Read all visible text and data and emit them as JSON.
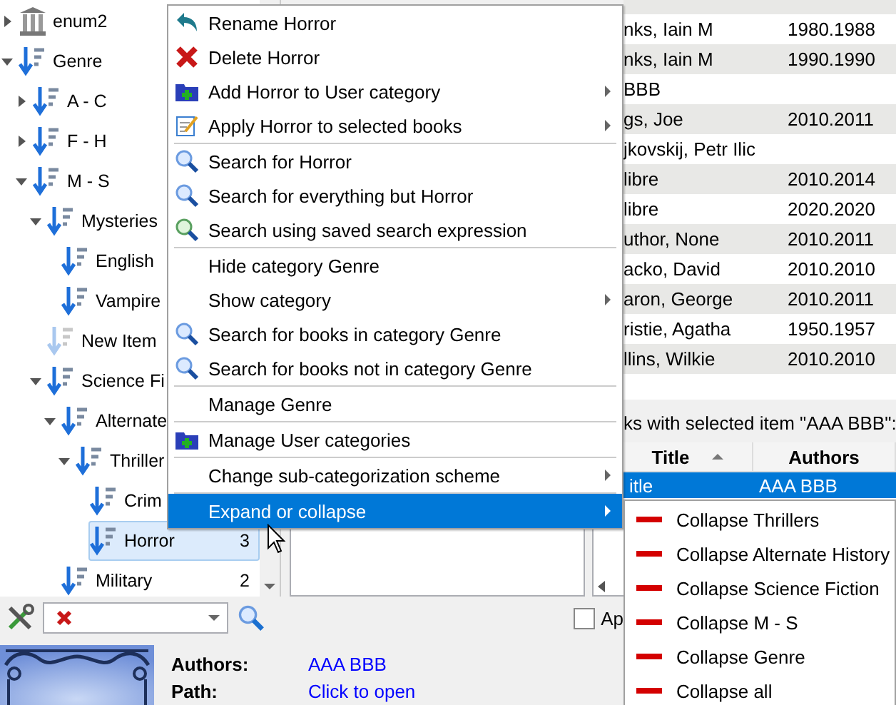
{
  "tree": [
    {
      "label": "enum2",
      "kind": "enum",
      "expanded": false,
      "faded": false,
      "selected": false
    },
    {
      "label": "Genre",
      "kind": "category",
      "expanded": true,
      "faded": false,
      "selected": false,
      "children": [
        {
          "label": "A - C",
          "kind": "category",
          "expanded": false,
          "faded": false,
          "selected": false
        },
        {
          "label": "F - H",
          "kind": "category",
          "expanded": false,
          "faded": false,
          "selected": false
        },
        {
          "label": "M - S",
          "kind": "category",
          "expanded": true,
          "faded": false,
          "selected": false,
          "children": [
            {
              "label": "Mysteries",
              "kind": "category",
              "expanded": true,
              "faded": false,
              "selected": false,
              "children": [
                {
                  "label": "English",
                  "kind": "category",
                  "faded": false,
                  "selected": false
                },
                {
                  "label": "Vampire",
                  "kind": "category",
                  "faded": false,
                  "selected": false
                }
              ]
            },
            {
              "label": "New Item",
              "kind": "category",
              "faded": true,
              "selected": false
            },
            {
              "label": "Science Fi",
              "kind": "category",
              "expanded": true,
              "faded": false,
              "selected": false,
              "children": [
                {
                  "label": "Alternate",
                  "kind": "category",
                  "expanded": true,
                  "faded": false,
                  "selected": false,
                  "children": [
                    {
                      "label": "Thriller",
                      "kind": "category",
                      "expanded": true,
                      "faded": false,
                      "selected": false,
                      "children": [
                        {
                          "label": "Crim",
                          "kind": "category",
                          "faded": false,
                          "selected": false
                        },
                        {
                          "label": "Horror",
                          "kind": "category",
                          "faded": false,
                          "selected": true,
                          "count": "3"
                        }
                      ]
                    }
                  ]
                },
                {
                  "label": "Military",
                  "kind": "category",
                  "faded": false,
                  "selected": false,
                  "count": "2"
                }
              ]
            }
          ]
        }
      ]
    }
  ],
  "context_menu": [
    {
      "kind": "undo",
      "label": "Rename Horror",
      "submenu": false,
      "selected": false
    },
    {
      "kind": "delete",
      "label": "Delete Horror",
      "submenu": false,
      "selected": false
    },
    {
      "kind": "folder",
      "label": "Add Horror to User category",
      "submenu": true,
      "selected": false
    },
    {
      "kind": "edit",
      "label": "Apply Horror to selected books",
      "submenu": true,
      "selected": false
    },
    {
      "kind": "separator"
    },
    {
      "kind": "search",
      "label": "Search for Horror",
      "submenu": false,
      "selected": false
    },
    {
      "kind": "search",
      "label": "Search for everything but Horror",
      "submenu": false,
      "selected": false
    },
    {
      "kind": "saved",
      "label": "Search using saved search expression",
      "submenu": false,
      "selected": false
    },
    {
      "kind": "separator"
    },
    {
      "kind": "plain",
      "label": "Hide category Genre",
      "submenu": false,
      "selected": false
    },
    {
      "kind": "plain",
      "label": "Show category",
      "submenu": true,
      "selected": false
    },
    {
      "kind": "search",
      "label": "Search for books in category Genre",
      "submenu": false,
      "selected": false
    },
    {
      "kind": "search",
      "label": "Search for books not in category Genre",
      "submenu": false,
      "selected": false
    },
    {
      "kind": "separator"
    },
    {
      "kind": "plain",
      "label": "Manage Genre",
      "submenu": false,
      "selected": false
    },
    {
      "kind": "separator"
    },
    {
      "kind": "folder",
      "label": "Manage User categories",
      "submenu": false,
      "selected": false
    },
    {
      "kind": "separator"
    },
    {
      "kind": "plain",
      "label": "Change sub-categorization scheme",
      "submenu": true,
      "selected": false
    },
    {
      "kind": "separator"
    },
    {
      "kind": "plain",
      "label": "Expand or collapse",
      "submenu": true,
      "selected": true
    }
  ],
  "submenu": [
    {
      "label": "Collapse Thrillers"
    },
    {
      "label": "Collapse Alternate History"
    },
    {
      "label": "Collapse Science Fiction"
    },
    {
      "label": "Collapse M - S"
    },
    {
      "label": "Collapse Genre"
    },
    {
      "label": "Collapse all"
    }
  ],
  "books_table": {
    "rows": [
      {
        "author": "nks, Iain M",
        "date": "1980.1988"
      },
      {
        "author": "nks, Iain M",
        "date": "1990.1990"
      },
      {
        "author": "BBB",
        "date": ""
      },
      {
        "author": "gs, Joe",
        "date": "2010.2011"
      },
      {
        "author": "jkovskij, Petr Ilic",
        "date": ""
      },
      {
        "author": "libre",
        "date": "2010.2014"
      },
      {
        "author": "libre",
        "date": "2020.2020"
      },
      {
        "author": "uthor, None",
        "date": "2010.2011"
      },
      {
        "author": "acko, David",
        "date": "2010.2010"
      },
      {
        "author": "aron, George",
        "date": "2010.2011"
      },
      {
        "author": "ristie, Agatha",
        "date": "1950.1957"
      },
      {
        "author": "llins, Wilkie",
        "date": "2010.2010"
      }
    ]
  },
  "match_panel": {
    "caption": "ks with selected item \"AAA BBB\":",
    "columns": [
      "Title",
      "Authors"
    ],
    "rows": [
      {
        "cells": [
          "itle",
          "AAA BBB"
        ],
        "selected": true
      }
    ]
  },
  "apply_checkbox": {
    "label": "Ap",
    "checked": false
  },
  "details": {
    "fields": [
      {
        "label": "Authors:",
        "value": "AAA BBB"
      },
      {
        "label": "Path:",
        "value": "Click to open"
      }
    ]
  }
}
